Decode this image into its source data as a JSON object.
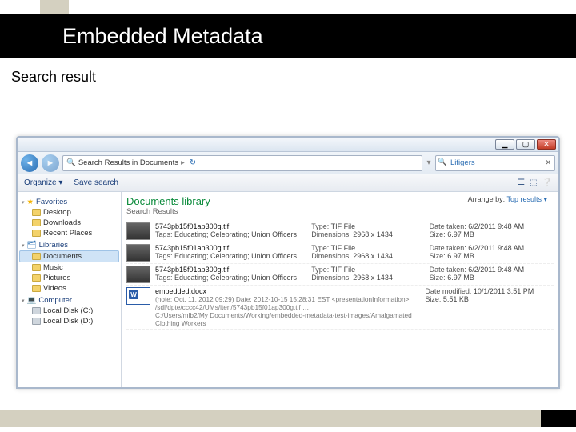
{
  "slide": {
    "title": "Embedded Metadata",
    "subtitle": "Search result"
  },
  "window": {
    "controls": {
      "min": "▁",
      "max": "▢",
      "close": "✕"
    },
    "breadcrumb": {
      "icon": "🔍",
      "text": "Search Results in Documents",
      "sep": "▸"
    },
    "search": {
      "term": "Lifigers",
      "clear": "✕"
    }
  },
  "toolbar": {
    "organize": "Organize ▾",
    "save": "Save search",
    "icons": [
      "☰",
      "⬚",
      "❔"
    ]
  },
  "navpane": {
    "favorites": {
      "label": "Favorites",
      "items": [
        "Desktop",
        "Downloads",
        "Recent Places"
      ]
    },
    "libraries": {
      "label": "Libraries",
      "items": [
        "Documents",
        "Music",
        "Pictures",
        "Videos"
      ],
      "selected": 0
    },
    "computer": {
      "label": "Computer",
      "items": [
        "Local Disk (C:)",
        "Local Disk (D:)"
      ]
    }
  },
  "library": {
    "title": "Documents library",
    "subtitle": "Search Results",
    "arrange_label": "Arrange by:",
    "arrange_value": "Top results ▾"
  },
  "results": {
    "tif": [
      {
        "name": "5743pb15f01ap300g.tif",
        "tags_label": "Tags:",
        "tags": "Educating; Celebrating; Union Officers",
        "type_label": "Type:",
        "type": "TIF File",
        "dim_label": "Dimensions:",
        "dim": "2968 x 1434",
        "date_label": "Date taken:",
        "date": "6/2/2011 9:48 AM",
        "size_label": "Size:",
        "size": "6.97 MB"
      },
      {
        "name": "5743pb15f01ap300g.tif",
        "tags_label": "Tags:",
        "tags": "Educating; Celebrating; Union Officers",
        "type_label": "Type:",
        "type": "TIF File",
        "dim_label": "Dimensions:",
        "dim": "2968 x 1434",
        "date_label": "Date taken:",
        "date": "6/2/2011 9:48 AM",
        "size_label": "Size:",
        "size": "6.97 MB"
      },
      {
        "name": "5743pb15f01ap300g.tif",
        "tags_label": "Tags:",
        "tags": "Educating; Celebrating; Union Officers",
        "type_label": "Type:",
        "type": "TIF File",
        "dim_label": "Dimensions:",
        "dim": "2968 x 1434",
        "date_label": "Date taken:",
        "date": "6/2/2011 9:48 AM",
        "size_label": "Size:",
        "size": "6.97 MB"
      }
    ],
    "docx": {
      "name": "embedded.docx",
      "snippet": "(note: Oct. 11, 2012 09:29) Date: 2012-10-15 15:28:31 EST <presentationInformation> /sdl/dpte/cccc42/UMs/iten/5743pb15f01ap300g.tif …",
      "path": "C:/Users/mlb2/My Documents/Working/embedded-metadata-test-images/Amalgamated Clothing Workers",
      "mod_label": "Date modified:",
      "mod": "10/1/2011 3:51 PM",
      "size_label": "Size:",
      "size": "5.51 KB"
    }
  }
}
